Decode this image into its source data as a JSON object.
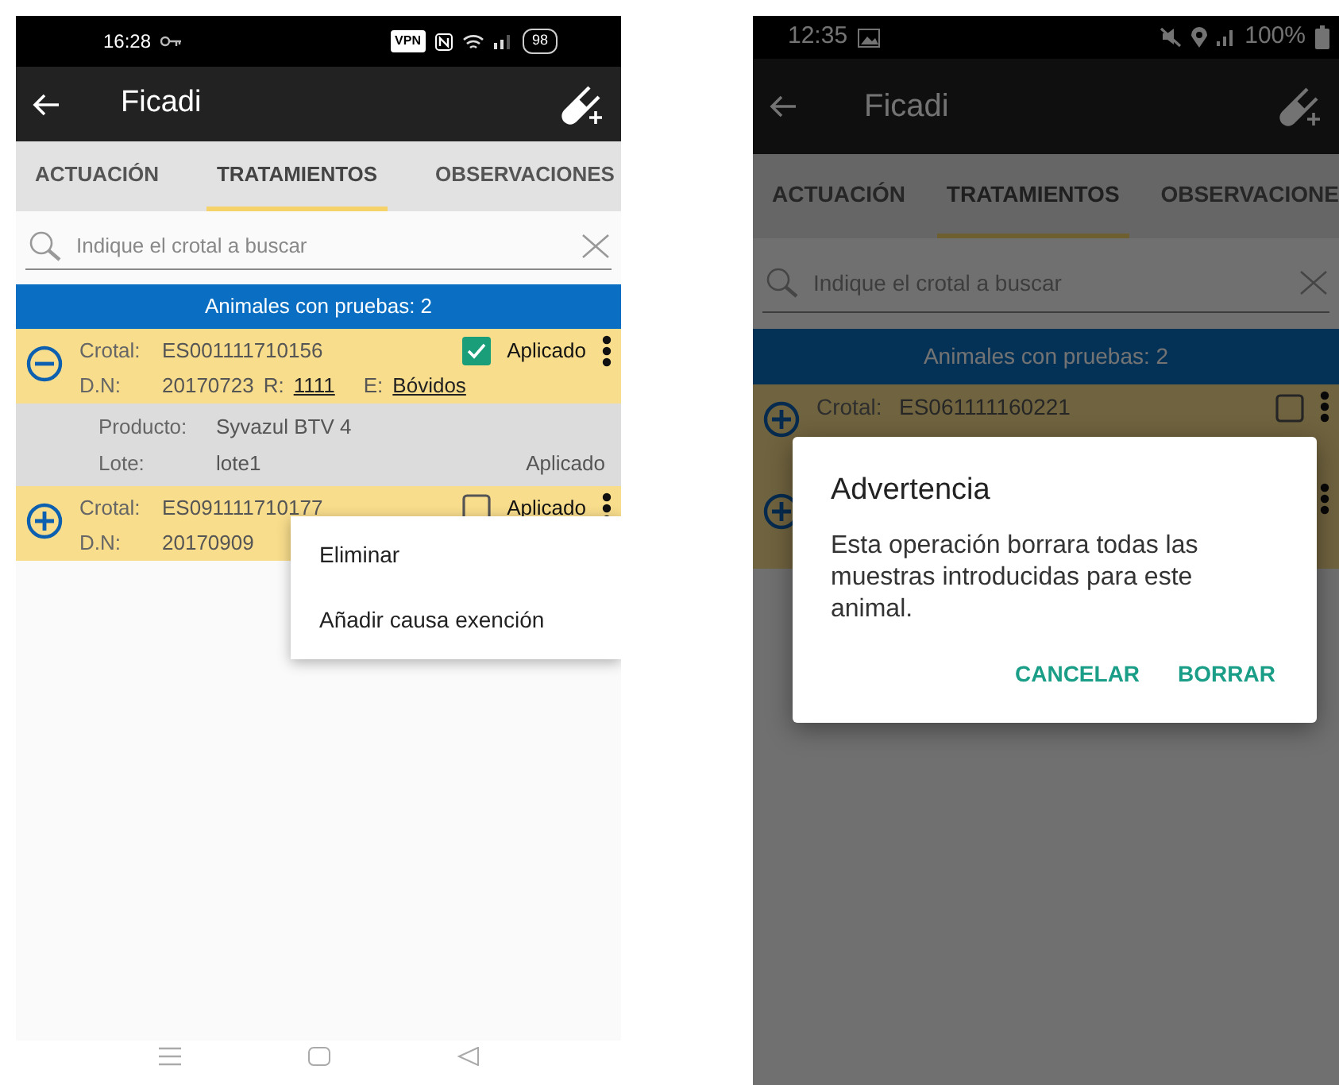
{
  "screens": [
    {
      "dimmed": false,
      "nav_bar": true,
      "status_bar": {
        "kind": "wifi",
        "time": "16:28",
        "vpn": "VPN",
        "battery": "98"
      },
      "app_bar": {
        "title": "Ficadi"
      },
      "tabs": [
        {
          "label": "ACTUACIÓN",
          "selected": false
        },
        {
          "label": "TRATAMIENTOS",
          "selected": true
        },
        {
          "label": "OBSERVACIONES",
          "selected": false
        }
      ],
      "search": {
        "placeholder": "Indique el crotal a buscar"
      },
      "list_header": "Animales con pruebas: 2",
      "animals": [
        {
          "expanded": true,
          "crotal_label": "Crotal:",
          "crotal": "ES001111710156",
          "checked": true,
          "applied_label": "Aplicado",
          "dn_label": "D.N:",
          "dn": "20170723",
          "r_label": "R:",
          "r": "1111",
          "e_label": "E:",
          "e": "Bóvidos",
          "detail": {
            "product_label": "Producto:",
            "product": "Syvazul BTV 4",
            "lot_label": "Lote:",
            "lot": "lote1",
            "status": "Aplicado"
          }
        },
        {
          "expanded": false,
          "crotal_label": "Crotal:",
          "crotal": "ES091111710177",
          "checked": false,
          "applied_label": "Aplicado",
          "dn_label": "D.N:",
          "dn": "20170909"
        }
      ],
      "context_menu": {
        "items": [
          "Eliminar",
          "Añadir causa exención"
        ]
      }
    },
    {
      "dimmed": true,
      "status_bar": {
        "kind": "location",
        "time": "12:35",
        "battery": "100%"
      },
      "app_bar": {
        "title": "Ficadi"
      },
      "tabs": [
        {
          "label": "ACTUACIÓN",
          "selected": false
        },
        {
          "label": "TRATAMIENTOS",
          "selected": true
        },
        {
          "label": "OBSERVACIONE",
          "selected": false
        }
      ],
      "search": {
        "placeholder": "Indique el crotal a buscar"
      },
      "list_header": "Animales con pruebas: 2",
      "animals": [
        {
          "expanded": false,
          "crotal_label": "Crotal:",
          "crotal": "ES061111160221",
          "checked": false
        },
        {
          "expanded": false
        }
      ],
      "dialog": {
        "title": "Advertencia",
        "message": "Esta operación borrara todas las muestras introducidas para este animal.",
        "buttons": [
          "CANCELAR",
          "BORRAR"
        ]
      }
    }
  ]
}
